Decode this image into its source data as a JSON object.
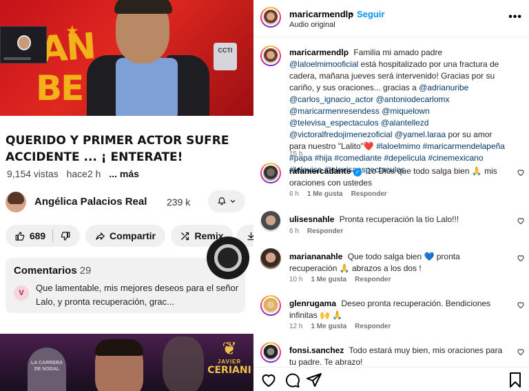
{
  "video": {
    "headline": "QUERIDO Y PRIMER  ACTOR SUFRE ACCIDENTE ... ¡ ENTERATE!",
    "views": "9,154 vistas",
    "time_ago": "hace2 h",
    "more": "... más",
    "channel_name": "Angélica Palacios Real",
    "subscribers": "239 k",
    "likes": "689",
    "share_label": "Compartir",
    "remix_label": "Remix",
    "comments_label": "Comentarios",
    "comments_count": "29",
    "top_comment_initial": "V",
    "top_comment": "Que lamentable,  mis mejores deseos para el señor Lalo, y pronta recuperación, grac...",
    "bg_text_1": "AN",
    "bg_text_2": "BE",
    "mic_label": "CCTI",
    "tomb_text": "LA CARRERA DE NODAL",
    "brand_line1": "JAVIER",
    "brand_line2": "CERIANI"
  },
  "post": {
    "username": "maricarmendlp",
    "dot": "•",
    "follow_label": "Seguir",
    "audio_label": "Audio original",
    "more_icon": "more-horizontal-icon",
    "caption": {
      "username": "maricarmendlp",
      "text_1": "Familia mi amado padre",
      "mention_1": "@laloelmimooficial",
      "text_2": "está hospitalizado por una fractura de cadera, mañana jueves será intervenido! Gracias por su cariño, y sus oraciones... gracias a",
      "mentions": "@adrianuribe @carlos_ignacio_actor @antoniodecarlomx @maricarmenresendess @miquelown @televisa_espectaculos @alantellezd @victoralfredojimenezoficial @yamel.laraa",
      "text_3": "por su amor para nuestro \"Lalito\"",
      "heart": "❤️",
      "hashtags": "#laloelmimo #maricarmendelapeña #papa #hija #comediante #depelicula #cinemexicano #televisa #televisaespectaculos",
      "time": "15 h"
    },
    "comments": [
      {
        "username": "rafamercadante",
        "verified": "✓",
        "text": "1o Dios que todo salga bien 🙏 mis oraciones con ustedes",
        "time": "6 h",
        "likes": "1 Me gusta",
        "reply": "Responder"
      },
      {
        "username": "ulisesnahle",
        "text": "Pronta recuperación la tío Lalo!!!",
        "time": "6 h",
        "reply": "Responder"
      },
      {
        "username": "mariananahle",
        "text": "Que todo salga bien 💙  pronta recuperación 🙏 abrazos a los dos !",
        "time": "10 h",
        "likes": "1 Me gusta",
        "reply": "Responder"
      },
      {
        "username": "glenrugama",
        "text": "Deseo pronta recuperación. Bendiciones infinitas 🙌 🙏",
        "time": "12 h",
        "likes": "1 Me gusta",
        "reply": "Responder"
      },
      {
        "username": "fonsi.sanchez",
        "text": "Todo estará muy bien, mis oraciones para tu padre. Te abrazo!",
        "time": "",
        "reply": ""
      }
    ]
  },
  "icons": [
    "heart-icon",
    "comment-icon",
    "share-icon",
    "bookmark-icon",
    "thumbs-up-icon",
    "thumbs-down-icon",
    "bell-icon",
    "chevron-down-icon"
  ],
  "colors": {
    "follow_blue": "#0095f6",
    "mention_blue": "#00376b",
    "video_red": "#c4121a"
  }
}
